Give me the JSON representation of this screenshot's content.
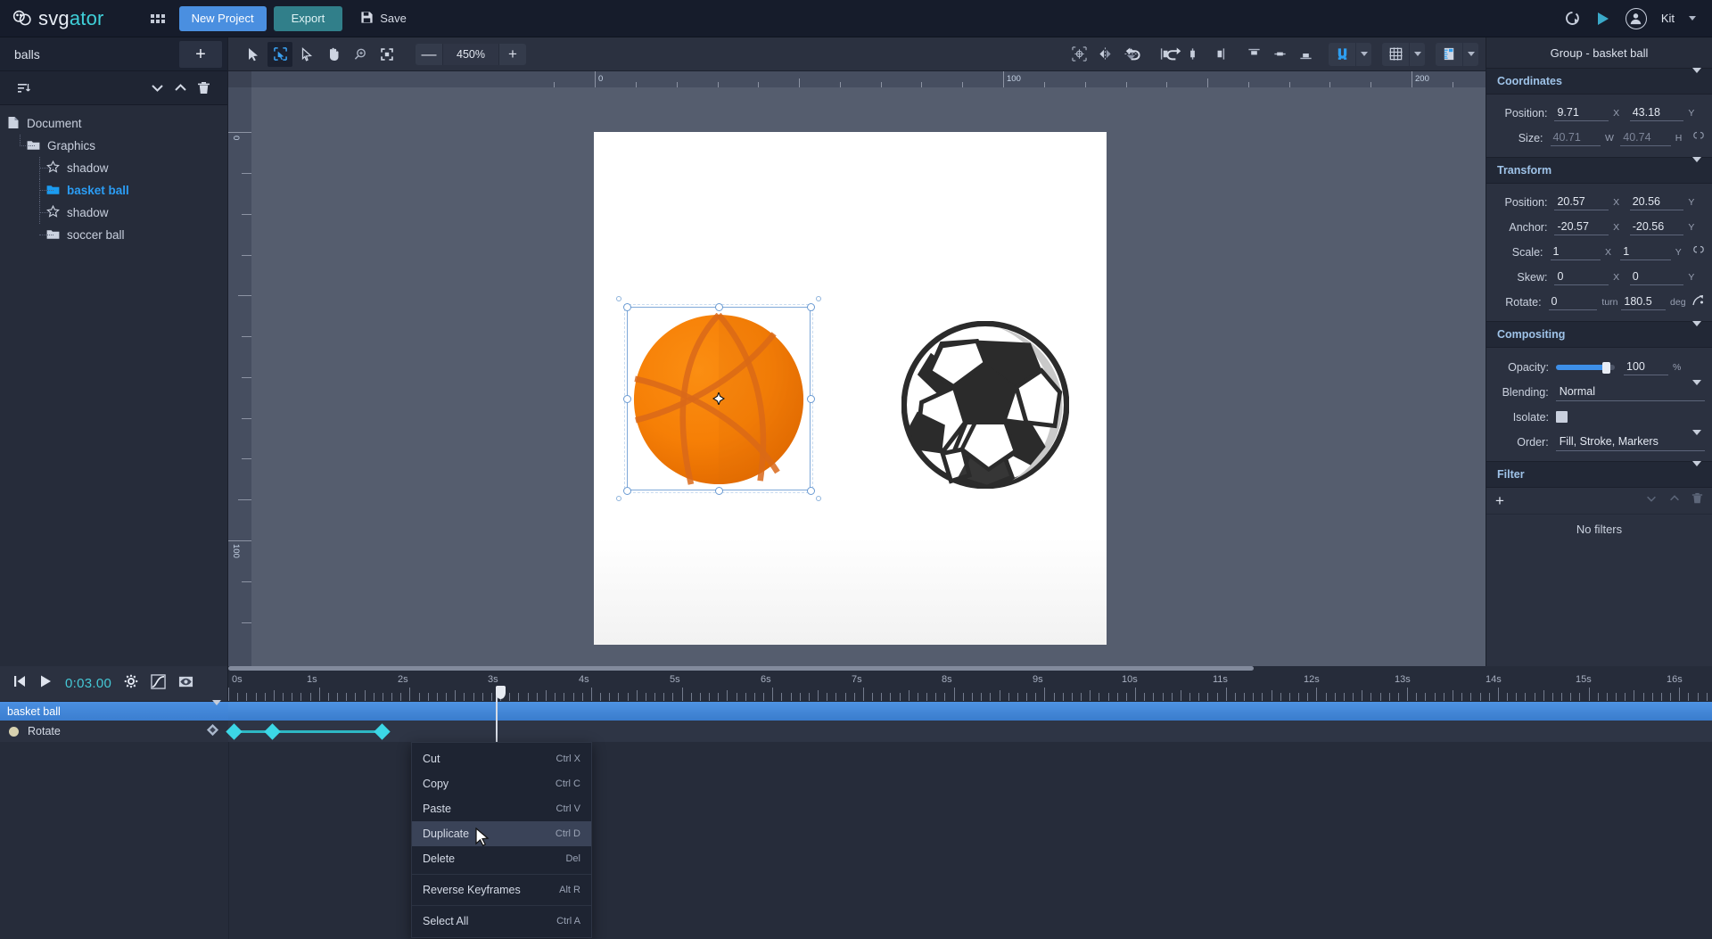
{
  "app": {
    "logo_a": "svg",
    "logo_b": "ator",
    "new_project": "New Project",
    "export": "Export",
    "save": "Save",
    "user_name": "Kit"
  },
  "left_panel": {
    "title": "balls",
    "add_label": "+",
    "tree": [
      {
        "label": "Document",
        "icon": "document-icon",
        "level": 0,
        "selected": false
      },
      {
        "label": "Graphics",
        "icon": "folder-icon",
        "level": 1,
        "selected": false
      },
      {
        "label": "shadow",
        "icon": "star-icon",
        "level": 2,
        "selected": false
      },
      {
        "label": "basket ball",
        "icon": "folder-filled-icon",
        "level": 2,
        "selected": true
      },
      {
        "label": "shadow",
        "icon": "star-icon",
        "level": 2,
        "selected": false
      },
      {
        "label": "soccer ball",
        "icon": "folder-icon",
        "level": 2,
        "selected": false
      }
    ]
  },
  "toolbar": {
    "zoom_level": "450%",
    "zoom_out": "—",
    "zoom_in": "+",
    "tools": [
      "select-arrow-icon",
      "transform-box-icon",
      "node-edit-icon",
      "pan-hand-icon",
      "zoom-area-icon",
      "fit-selection-icon"
    ],
    "history": [
      "undo-icon",
      "redo-icon"
    ],
    "align_tools": [
      "align-anchor-icon",
      "flip-horizontal-icon",
      "flip-vertical-icon",
      "align-left-icon",
      "align-center-h-icon",
      "align-right-icon",
      "align-top-icon",
      "align-middle-v-icon",
      "align-bottom-icon"
    ],
    "snap_icon": "magnet-icon",
    "grid_icon": "grid-icon",
    "ruler_icon": "ruler-icon"
  },
  "canvas": {
    "ruler_h_labels": [
      "0",
      "100",
      "200"
    ],
    "ruler_v_labels": [
      "0",
      "100"
    ],
    "shapes": [
      {
        "name": "basket ball",
        "type": "basketball",
        "selected": true
      },
      {
        "name": "soccer ball",
        "type": "soccerball",
        "selected": false
      }
    ]
  },
  "right_panel": {
    "header": "Group - basket ball",
    "sections": [
      {
        "title": "Coordinates",
        "rows": [
          {
            "label": "Position:",
            "x": "9.71",
            "x_unit": "X",
            "y": "43.18",
            "y_unit": "Y",
            "dim": false
          },
          {
            "label": "Size:",
            "x": "40.71",
            "x_unit": "W",
            "y": "40.74",
            "y_unit": "H",
            "dim": true,
            "ext": "link-icon"
          }
        ]
      },
      {
        "title": "Transform",
        "rows": [
          {
            "label": "Position:",
            "x": "20.57",
            "x_unit": "X",
            "y": "20.56",
            "y_unit": "Y",
            "dim": false
          },
          {
            "label": "Anchor:",
            "x": "-20.57",
            "x_unit": "X",
            "y": "-20.56",
            "y_unit": "Y",
            "dim": false
          },
          {
            "label": "Scale:",
            "x": "1",
            "x_unit": "X",
            "y": "1",
            "y_unit": "Y",
            "dim": false,
            "ext": "link-icon"
          },
          {
            "label": "Skew:",
            "x": "0",
            "x_unit": "X",
            "y": "0",
            "y_unit": "Y",
            "dim": false
          },
          {
            "label": "Rotate:",
            "x": "0",
            "x_unit": "turn",
            "y": "180.5",
            "y_unit": "deg",
            "dim": false,
            "ext": "rotate-anchor-icon"
          }
        ]
      }
    ],
    "compositing": {
      "title": "Compositing",
      "opacity_label": "Opacity:",
      "opacity_value": "100",
      "opacity_unit": "%",
      "blending_label": "Blending:",
      "blending_value": "Normal",
      "isolate_label": "Isolate:",
      "order_label": "Order:",
      "order_value": "Fill, Stroke, Markers"
    },
    "filter": {
      "title": "Filter",
      "add": "+",
      "empty": "No filters"
    },
    "accent": "#9fc3e8"
  },
  "timeline": {
    "current_time": "0:03.00",
    "controls": [
      "skip-start-icon",
      "play-icon",
      "settings-gear-icon",
      "easing-icon",
      "onion-skin-icon"
    ],
    "selected_layer": "basket ball",
    "property": "Rotate",
    "ruler_labels": [
      "0s",
      "1s",
      "2s",
      "3s",
      "4s",
      "5s",
      "6s",
      "7s",
      "8s",
      "9s",
      "10s",
      "11s",
      "12s",
      "13s",
      "14s",
      "15s",
      "16s"
    ],
    "playhead_seconds": 3,
    "keyframes_seconds": [
      0,
      0.55,
      2.0
    ]
  },
  "context_menu": {
    "items": [
      {
        "label": "Cut",
        "shortcut": "Ctrl X",
        "highlighted": false,
        "sep_after": false
      },
      {
        "label": "Copy",
        "shortcut": "Ctrl C",
        "highlighted": false,
        "sep_after": false
      },
      {
        "label": "Paste",
        "shortcut": "Ctrl V",
        "highlighted": false,
        "sep_after": false
      },
      {
        "label": "Duplicate",
        "shortcut": "Ctrl D",
        "highlighted": true,
        "sep_after": false
      },
      {
        "label": "Delete",
        "shortcut": "Del",
        "highlighted": false,
        "sep_after": true
      },
      {
        "label": "Reverse Keyframes",
        "shortcut": "Alt R",
        "highlighted": false,
        "sep_after": true
      },
      {
        "label": "Select All",
        "shortcut": "Ctrl A",
        "highlighted": false,
        "sep_after": false
      }
    ]
  },
  "colors": {
    "accent_blue": "#4a8fe0",
    "export_teal": "#317f8a",
    "selected_layer": "#2b9df4",
    "keyframe_cyan": "#3cd7e6",
    "time_cyan": "#45c8d6",
    "basketball_orange": "#f57c05"
  }
}
